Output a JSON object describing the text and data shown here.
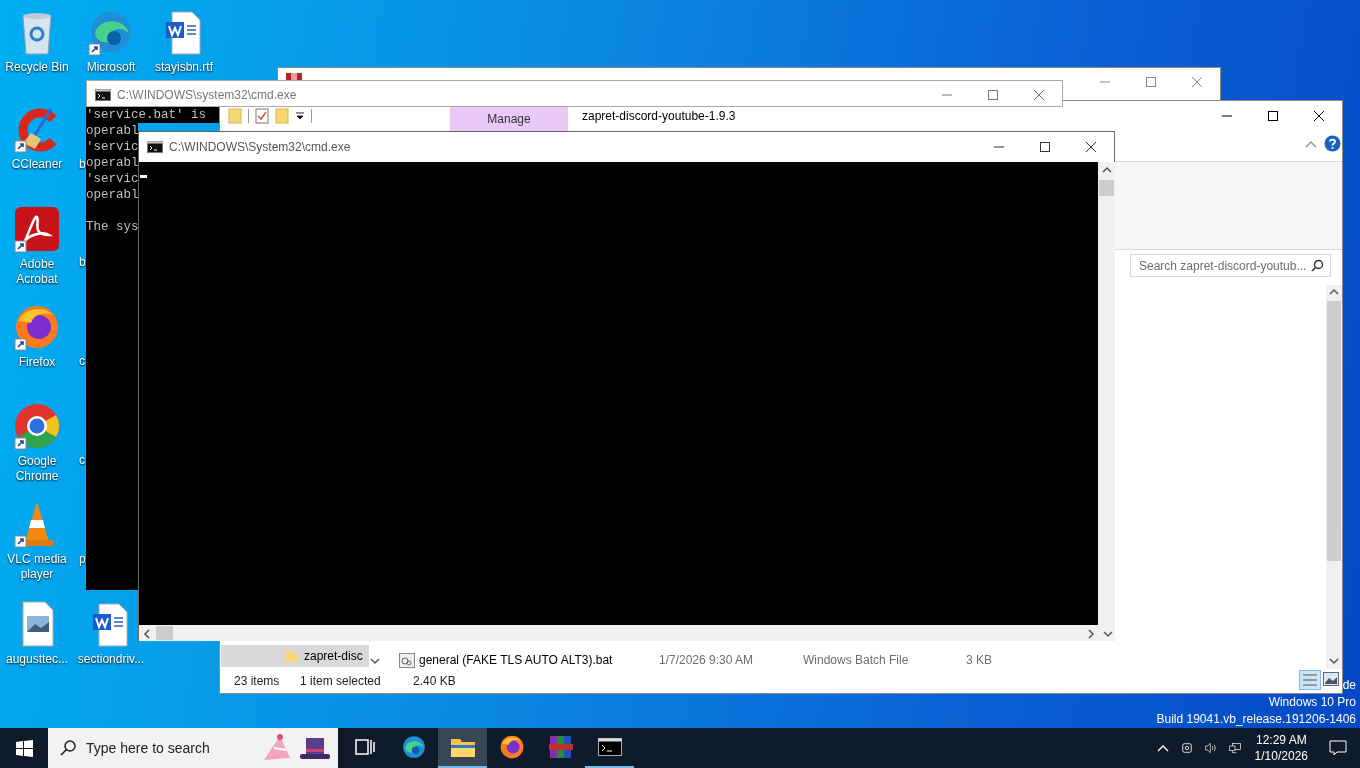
{
  "desktop_icons": [
    {
      "kind": "recycle-bin",
      "label": "Recycle Bin"
    },
    {
      "kind": "edge",
      "label": "Microsoft"
    },
    {
      "kind": "word",
      "label": "stayisbn.rtf"
    },
    {
      "kind": "ccleaner",
      "label": "CCleaner"
    },
    {
      "kind": "acrobat",
      "label": "Adobe Acrobat"
    },
    {
      "kind": "firefox",
      "label": "Firefox"
    },
    {
      "kind": "chrome",
      "label": "Google Chrome"
    },
    {
      "kind": "vlc",
      "label": "VLC media player"
    },
    {
      "kind": "image",
      "label": "augusttec..."
    },
    {
      "kind": "word",
      "label": "sectiondriv..."
    }
  ],
  "partial_icon_labels": [
    "b",
    "b",
    "c",
    "c",
    "p"
  ],
  "explorer": {
    "title": "zapret-discord-youtube-1.9.3",
    "ribbon_tab": "Manage",
    "search": {
      "placeholder": "Search zapret-discord-youtub..."
    },
    "nav_item": {
      "label": "zapret-disc",
      "selected": true
    },
    "files": [
      {
        "name": "general (FAKE TLS AUTO ALT3).bat",
        "date": "1/7/2026 9:30 AM",
        "type": "Windows Batch File",
        "size": "3 KB"
      }
    ],
    "status": {
      "count": "23 items",
      "selection": "1 item selected",
      "size": "2.40 KB"
    }
  },
  "cmd_back": {
    "title": "C:\\WINDOWS\\system32\\cmd.exe",
    "lines": [
      {
        "kind": "text",
        "text": "'service.bat' is"
      },
      {
        "kind": "text",
        "text": "operabl"
      },
      {
        "kind": "text",
        "text": "'servic"
      },
      {
        "kind": "text",
        "text": "operabl"
      },
      {
        "kind": "text",
        "text": "'servic"
      },
      {
        "kind": "text",
        "text": "operabl"
      },
      {
        "kind": "blank"
      },
      {
        "kind": "text",
        "text": "The sys"
      }
    ]
  },
  "cmd_front": {
    "title": "C:\\WINDOWS\\System32\\cmd.exe"
  },
  "system_watermark": [
    "de",
    "Windows 10 Pro",
    "Build 19041.vb_release.191206-1406"
  ],
  "taskbar": {
    "search_placeholder": "Type here to search",
    "apps": [
      {
        "kind": "task-view",
        "running": false,
        "selected": false
      },
      {
        "kind": "edge",
        "running": false,
        "selected": false
      },
      {
        "kind": "explorer",
        "running": true,
        "selected": true
      },
      {
        "kind": "firefox",
        "running": false,
        "selected": false
      },
      {
        "kind": "winrar",
        "running": false,
        "selected": false
      },
      {
        "kind": "cmd",
        "running": true,
        "selected": false
      }
    ],
    "time": "12:29 AM",
    "date": "1/10/2026"
  }
}
